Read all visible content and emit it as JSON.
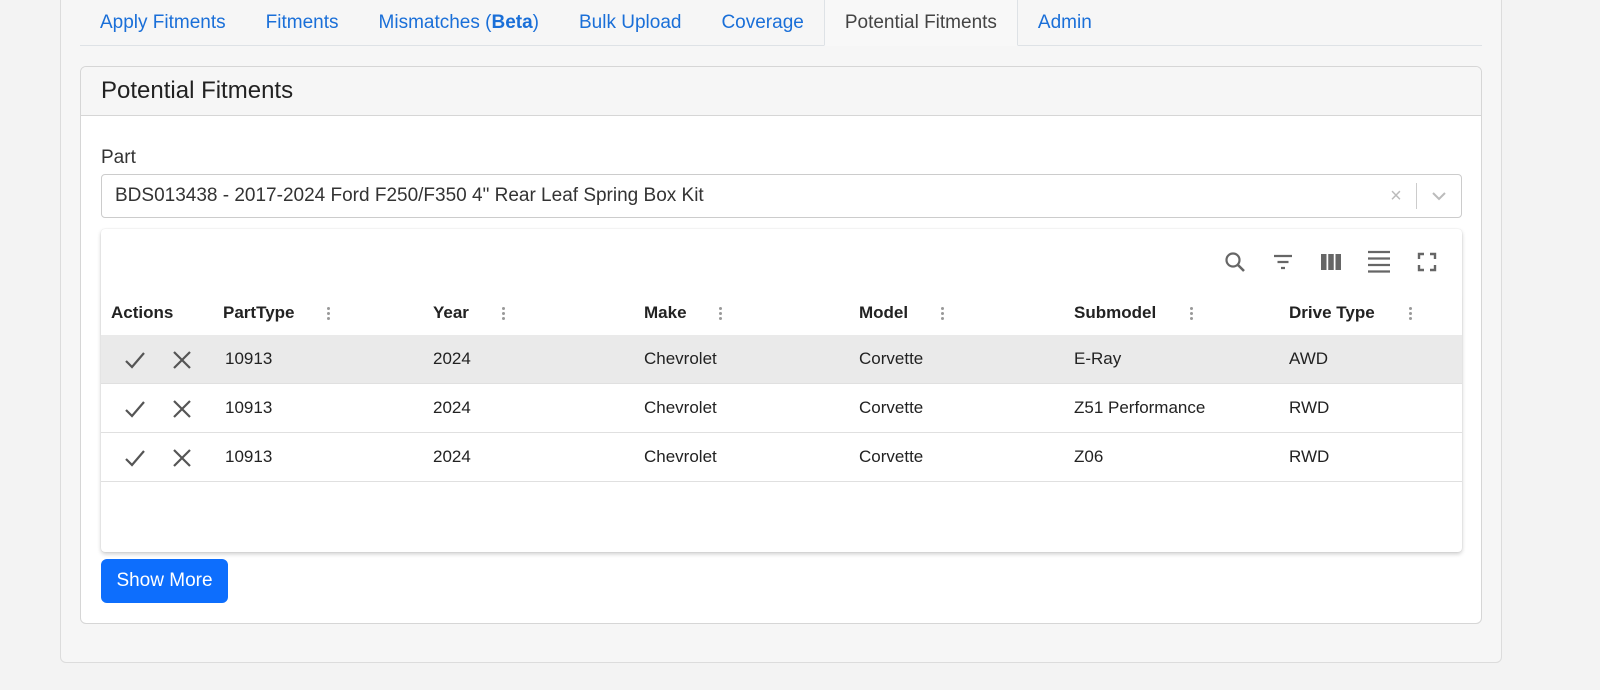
{
  "tabs": [
    {
      "label": "Apply Fitments"
    },
    {
      "label": "Fitments"
    },
    {
      "label_prefix": "Mismatches (",
      "label_bold": "Beta",
      "label_suffix": ")"
    },
    {
      "label": "Bulk Upload"
    },
    {
      "label": "Coverage"
    },
    {
      "label": "Potential Fitments",
      "active": true
    },
    {
      "label": "Admin"
    }
  ],
  "card": {
    "title": "Potential Fitments"
  },
  "part": {
    "label": "Part",
    "value": "BDS013438 - 2017-2024 Ford F250/F350 4\" Rear Leaf Spring Box Kit",
    "clear_glyph": "×"
  },
  "toolbar": {
    "icons": [
      "search-icon",
      "filter-icon",
      "columns-icon",
      "density-icon",
      "fullscreen-icon"
    ]
  },
  "table": {
    "columns": [
      "Actions",
      "PartType",
      "Year",
      "Make",
      "Model",
      "Submodel",
      "Drive Type"
    ],
    "rows": [
      {
        "parttype": "10913",
        "year": "2024",
        "make": "Chevrolet",
        "model": "Corvette",
        "submodel": "E-Ray",
        "drive": "AWD"
      },
      {
        "parttype": "10913",
        "year": "2024",
        "make": "Chevrolet",
        "model": "Corvette",
        "submodel": "Z51 Performance",
        "drive": "RWD"
      },
      {
        "parttype": "10913",
        "year": "2024",
        "make": "Chevrolet",
        "model": "Corvette",
        "submodel": "Z06",
        "drive": "RWD"
      }
    ]
  },
  "show_more": "Show More",
  "colors": {
    "accent": "#0d6efd",
    "link": "#1a6fd8"
  }
}
